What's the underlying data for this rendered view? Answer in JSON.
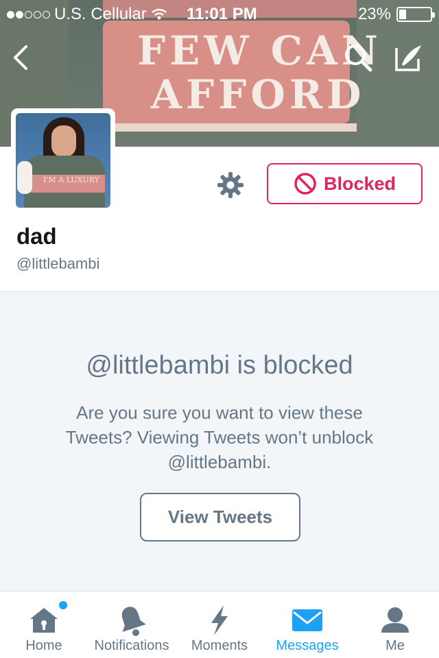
{
  "status_bar": {
    "carrier": "U.S. Cellular",
    "time": "11:01 PM",
    "battery": "23%",
    "signal_dots_filled": 2,
    "signal_dots_total": 5,
    "battery_level": 0.23
  },
  "header": {
    "banner_text_line1": "FEW CAN",
    "banner_text_line2": "AFFORD",
    "back_icon": "chevron-left-icon",
    "search_icon": "search-icon",
    "compose_icon": "compose-icon"
  },
  "avatar": {
    "text": "I'M A LUXURY"
  },
  "profile": {
    "name": "dad",
    "handle": "@littlebambi",
    "settings_icon": "gear-icon",
    "blocked_label": "Blocked",
    "blocked_icon": "no-entry-icon"
  },
  "blocked_panel": {
    "title": "@littlebambi is blocked",
    "message": "Are you sure you want to view these Tweets? Viewing Tweets won’t unblock @littlebambi.",
    "view_button": "View Tweets"
  },
  "tabs": [
    {
      "label": "Home",
      "icon": "home-icon",
      "active": false,
      "has_dot": true
    },
    {
      "label": "Notifications",
      "icon": "bell-icon",
      "active": false,
      "has_dot": false
    },
    {
      "label": "Moments",
      "icon": "lightning-icon",
      "active": false,
      "has_dot": false
    },
    {
      "label": "Messages",
      "icon": "envelope-icon",
      "active": true,
      "has_dot": false
    },
    {
      "label": "Me",
      "icon": "person-icon",
      "active": false,
      "has_dot": false
    }
  ],
  "colors": {
    "accent": "#1da1f2",
    "blocked": "#e0245e",
    "muted": "#657786"
  }
}
